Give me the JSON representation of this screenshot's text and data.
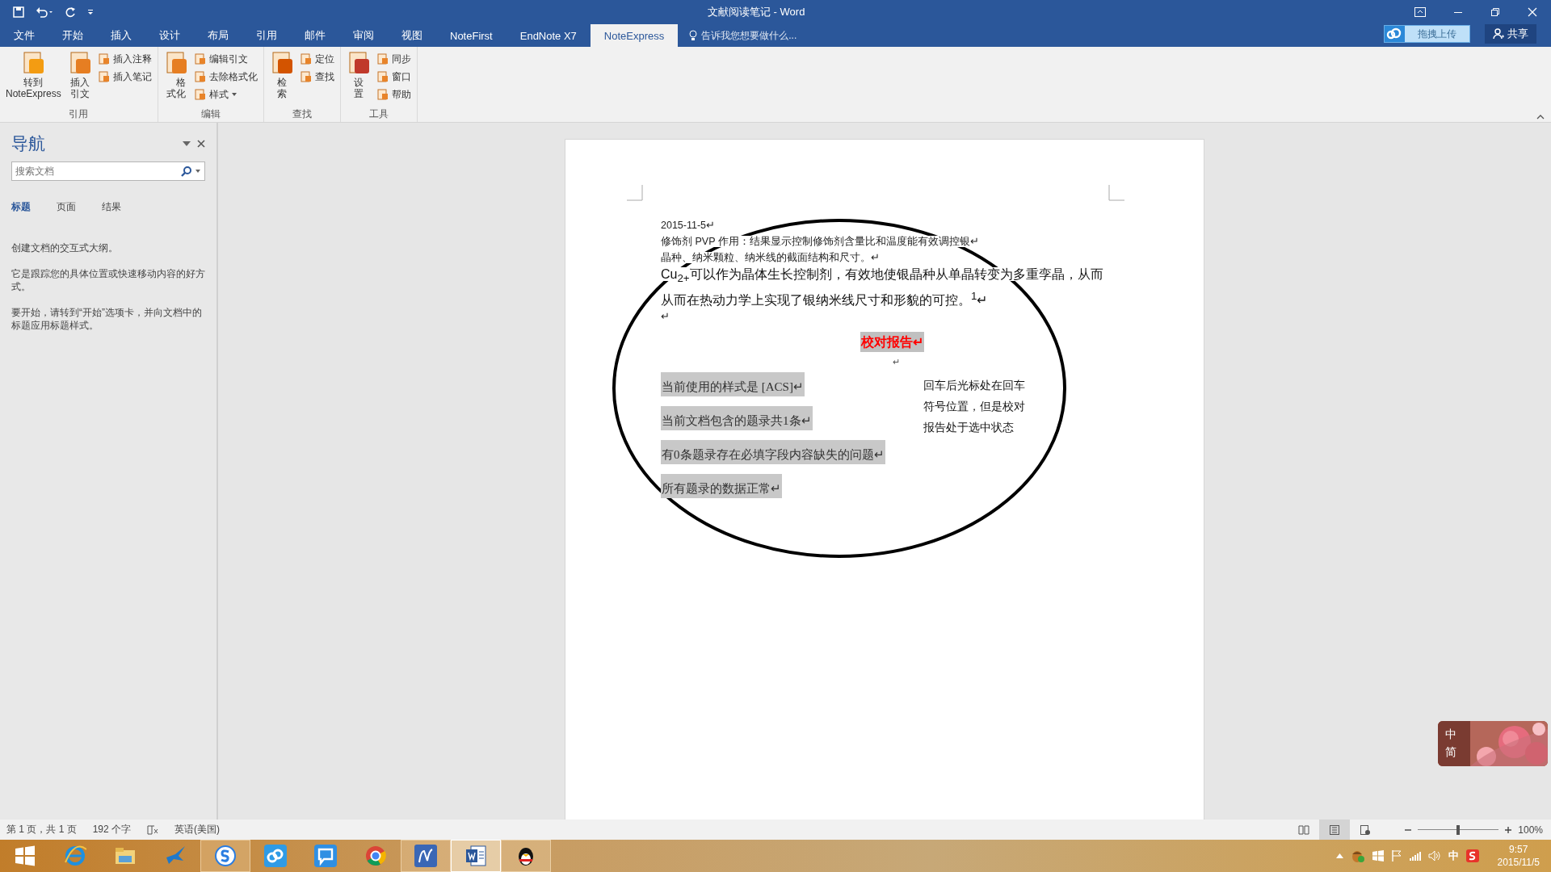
{
  "window": {
    "title": "文献阅读笔记 - Word"
  },
  "tabs": [
    {
      "label": "文件",
      "selected": false
    },
    {
      "label": "开始",
      "selected": false
    },
    {
      "label": "插入",
      "selected": false
    },
    {
      "label": "设计",
      "selected": false
    },
    {
      "label": "布局",
      "selected": false
    },
    {
      "label": "引用",
      "selected": false
    },
    {
      "label": "邮件",
      "selected": false
    },
    {
      "label": "审阅",
      "selected": false
    },
    {
      "label": "视图",
      "selected": false
    },
    {
      "label": "NoteFirst",
      "selected": false
    },
    {
      "label": "EndNote X7",
      "selected": false
    },
    {
      "label": "NoteExpress",
      "selected": true
    }
  ],
  "tell_me": {
    "placeholder": "告诉我您想要做什么..."
  },
  "upload_button": {
    "label": "拖拽上传"
  },
  "share_button": {
    "label": "共享"
  },
  "ribbon_groups": [
    {
      "label": "引用",
      "items": [
        {
          "kind": "large",
          "label": "转到\nNoteExpress"
        },
        {
          "kind": "large",
          "label": "插入引文"
        },
        {
          "kind": "stack",
          "buttons": [
            {
              "label": "插入注释",
              "dropdown": false
            },
            {
              "label": "插入笔记",
              "dropdown": false
            }
          ]
        }
      ]
    },
    {
      "label": "编辑",
      "items": [
        {
          "kind": "large",
          "label": "格式化"
        },
        {
          "kind": "stack",
          "buttons": [
            {
              "label": "编辑引文",
              "dropdown": false
            },
            {
              "label": "去除格式化",
              "dropdown": false
            },
            {
              "label": "样式",
              "dropdown": true
            }
          ]
        }
      ]
    },
    {
      "label": "查找",
      "items": [
        {
          "kind": "large",
          "label": "检索"
        },
        {
          "kind": "stack",
          "buttons": [
            {
              "label": "定位",
              "dropdown": false
            },
            {
              "label": "查找",
              "dropdown": false
            }
          ]
        }
      ]
    },
    {
      "label": "工具",
      "items": [
        {
          "kind": "large",
          "label": "设置"
        },
        {
          "kind": "stack",
          "buttons": [
            {
              "label": "同步",
              "dropdown": false
            },
            {
              "label": "窗口",
              "dropdown": false
            },
            {
              "label": "帮助",
              "dropdown": false
            }
          ]
        }
      ]
    }
  ],
  "navigation": {
    "title": "导航",
    "search": {
      "placeholder": "搜索文档"
    },
    "tabs": [
      {
        "label": "标题",
        "selected": true
      },
      {
        "label": "页面",
        "selected": false
      },
      {
        "label": "结果",
        "selected": false
      }
    ],
    "paragraphs": [
      "创建文档的交互式大纲。",
      "它是跟踪您的具体位置或快速移动内容的好方式。",
      "要开始，请转到“开始”选项卡，并向文档中的标题应用标题样式。"
    ]
  },
  "document": {
    "lines": [
      {
        "kind": "small",
        "text": "2015-11-5↵"
      },
      {
        "kind": "small",
        "text": "修饰剂 PVP 作用：结果显示控制修饰剂含量比和温度能有效调控银↵"
      },
      {
        "kind": "small",
        "text": "晶种、纳米颗粒、纳米线的截面结构和尺寸。↵"
      },
      {
        "kind": "large",
        "text": "Cu$_{2+}$可以作为晶体生长控制剂，有效地使银晶种从单晶转变为多重孪晶，从而"
      },
      {
        "kind": "large",
        "text": "从而在热动力学上实现了银纳米线尺寸和形貌的可控。$^{1}$↵"
      },
      {
        "kind": "small",
        "text": "↵"
      }
    ],
    "report_title": "校对报告↵",
    "blank_mark": "↵",
    "report_items": [
      "当前使用的样式是 [ACS]↵",
      "当前文档包含的题录共1条↵",
      "有0条题录存在必填字段内容缺失的问题↵",
      "所有题录的数据正常↵"
    ],
    "note_lines": [
      "回车后光标处在回车",
      "符号位置，但是校对",
      "报告处于选中状态"
    ]
  },
  "status_bar": {
    "page": "第 1 页，共 1 页",
    "words": "192 个字",
    "language": "英语(美国)",
    "views": [
      {
        "selected": false
      },
      {
        "selected": true
      },
      {
        "selected": false
      }
    ],
    "zoom": {
      "level": 0.5,
      "reading": "100%"
    }
  },
  "ime_widget": {
    "texts": [
      "中",
      "简"
    ]
  },
  "taskbar": {
    "apps": [
      {
        "running": false,
        "active": false
      },
      {
        "running": false,
        "active": false
      },
      {
        "running": false,
        "active": false
      },
      {
        "running": true,
        "active": false
      },
      {
        "running": false,
        "active": false
      },
      {
        "running": false,
        "active": false
      },
      {
        "running": false,
        "active": false
      },
      {
        "running": true,
        "active": false
      },
      {
        "running": true,
        "active": true
      },
      {
        "running": true,
        "active": false
      }
    ],
    "ime": "中",
    "time": "9:57",
    "date": "2015/11/5"
  }
}
